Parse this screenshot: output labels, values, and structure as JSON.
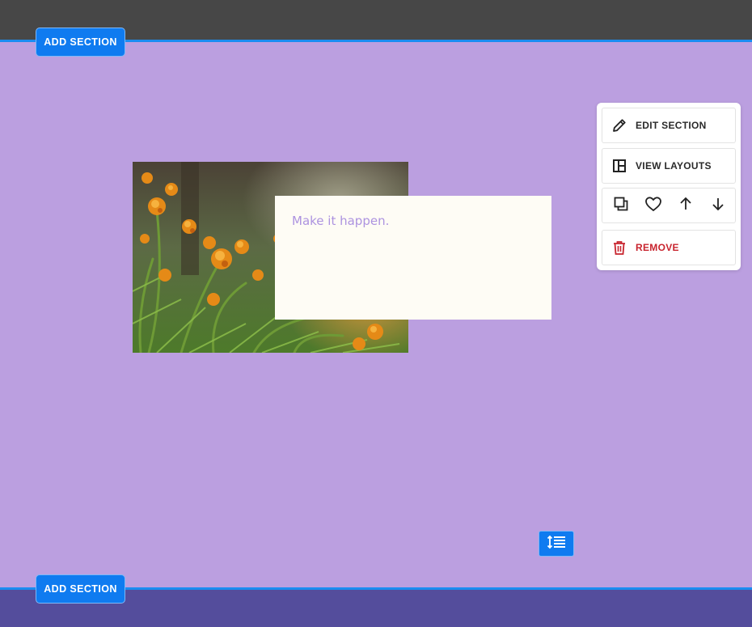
{
  "editor": {
    "add_section_top": "ADD SECTION",
    "add_section_bottom": "ADD SECTION"
  },
  "section": {
    "tagline": "Make it happen.",
    "image_subject": "orange marigold flowers"
  },
  "panel": {
    "edit_section": "EDIT SECTION",
    "view_layouts": "VIEW LAYOUTS",
    "remove": "REMOVE",
    "icons": [
      "pencil-icon",
      "layout-icon",
      "duplicate-icon",
      "heart-icon",
      "arrow-up-icon",
      "arrow-down-icon",
      "trash-icon",
      "resize-icon"
    ]
  },
  "colors": {
    "section_bg": "#bb9fe0",
    "accent_blue": "#0f7bf0",
    "remove_red": "#c8242e",
    "tagline": "#ad93e0",
    "topbar": "#474747",
    "next_section_bg": "#544d9c"
  }
}
